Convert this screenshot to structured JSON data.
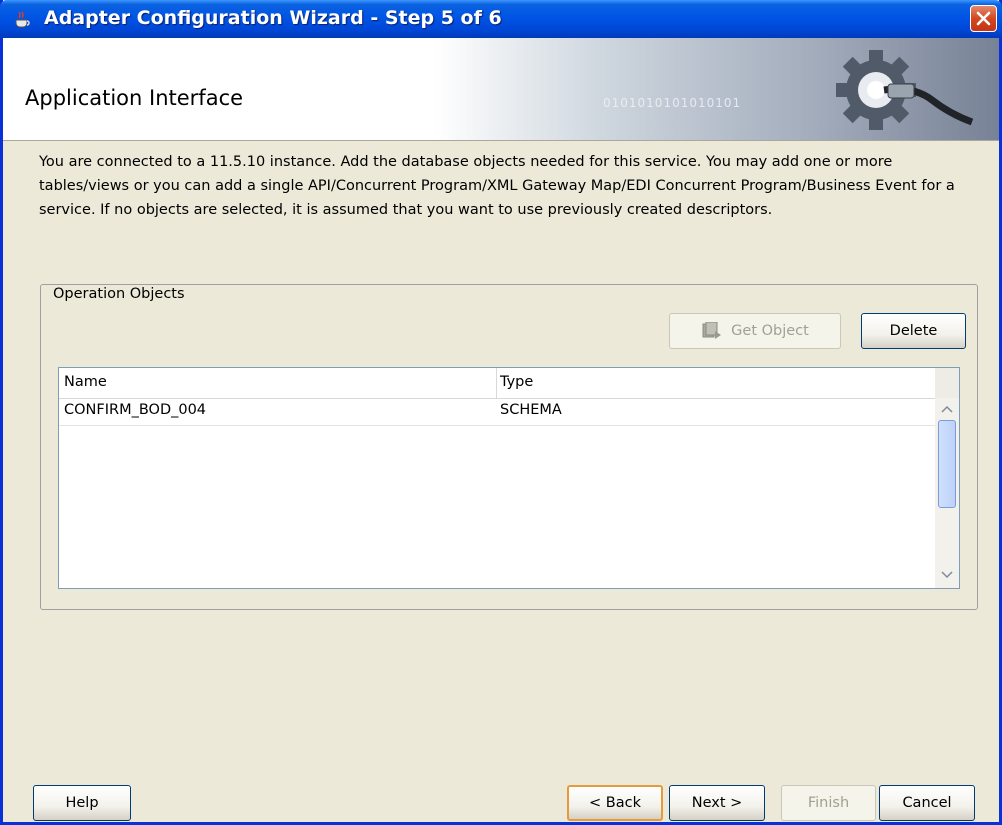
{
  "window": {
    "title": "Adapter Configuration Wizard - Step 5 of 6"
  },
  "header": {
    "title": "Application Interface",
    "art_text": "0101010101010101"
  },
  "description": "You are connected to a 11.5.10 instance. Add the database objects needed for this service. You may add one or more tables/views or you can add a single API/Concurrent Program/XML Gateway Map/EDI Concurrent Program/Business Event for a service. If no objects are selected, it is assumed that you want to use previously created descriptors.",
  "operation_objects": {
    "group_label": "Operation Objects",
    "get_object_label": "Get Object",
    "delete_label": "Delete",
    "columns": [
      "Name",
      "Type"
    ],
    "rows": [
      {
        "name": "CONFIRM_BOD_004",
        "type": "SCHEMA"
      }
    ]
  },
  "footer": {
    "help_label": "Help",
    "back_label": "< Back",
    "next_label": "Next >",
    "finish_label": "Finish",
    "cancel_label": "Cancel"
  },
  "icons": [
    "java-cup-icon",
    "close-icon",
    "gear-plug-icon",
    "get-object-icon",
    "scroll-up-icon",
    "scroll-down-icon"
  ],
  "colors": {
    "titlebar": "#0055e5",
    "close": "#d4471f",
    "panel": "#ece9d8",
    "focus": "#e59b3b"
  }
}
